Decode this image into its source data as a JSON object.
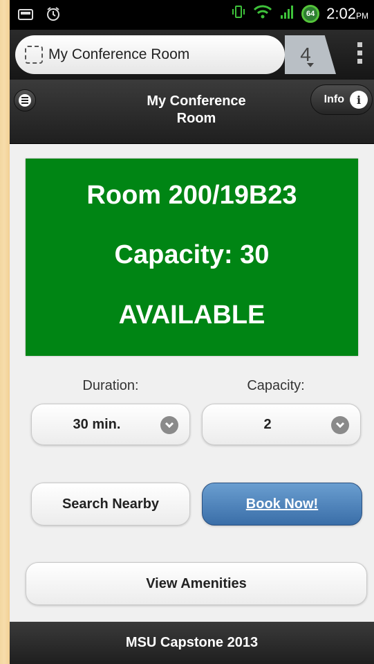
{
  "status_bar": {
    "battery_level": "64",
    "time": "2:02",
    "ampm": "PM"
  },
  "browser": {
    "page_title": "My Conference Room",
    "tab_count": "4"
  },
  "header": {
    "title_line1": "My Conference",
    "title_line2": "Room",
    "info_label": "Info"
  },
  "room": {
    "name": "Room 200/19B23",
    "capacity": "Capacity: 30",
    "status": "AVAILABLE",
    "status_color": "#008514"
  },
  "form": {
    "duration_label": "Duration:",
    "duration_value": "30 min.",
    "capacity_label": "Capacity:",
    "capacity_value": "2"
  },
  "actions": {
    "search_nearby": "Search Nearby",
    "book_now": "Book Now!",
    "view_amenities": "View Amenities"
  },
  "footer": {
    "text": "MSU Capstone 2013"
  }
}
